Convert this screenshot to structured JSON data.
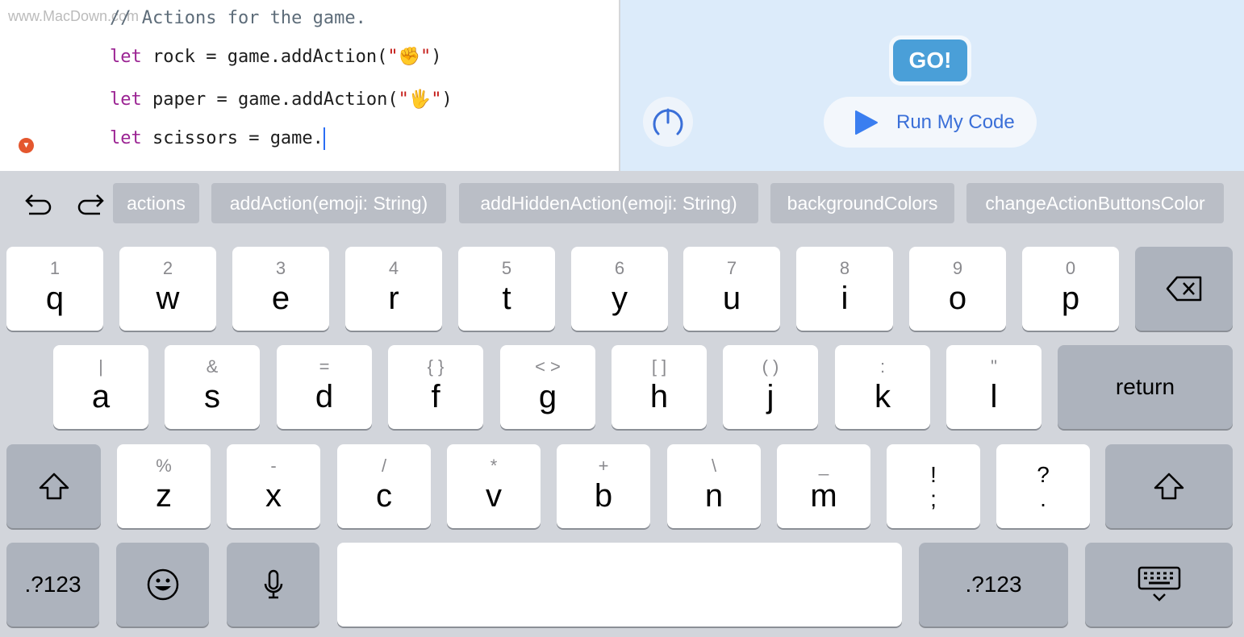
{
  "watermark": "www.MacDown.com",
  "code": {
    "comment": "// Actions for the game.",
    "lines": [
      {
        "kw": "let",
        "rest": " rock = game.addAction(",
        "q1": "\"",
        "emoji": "✊",
        "q2": "\"",
        "end": ")"
      },
      {
        "kw": "let",
        "rest": " paper = game.addAction(",
        "q1": "\"",
        "emoji": "🖐",
        "q2": "\"",
        "end": ")"
      },
      {
        "kw": "let",
        "rest": " scissors = game.",
        "q1": "",
        "emoji": "",
        "q2": "",
        "end": ""
      }
    ]
  },
  "live": {
    "go_label": "GO!",
    "run_label": "Run My Code",
    "accent": "#3a6fd8"
  },
  "suggestions": [
    "actions",
    "addAction(emoji: String)",
    "addHiddenAction(emoji: String)",
    "backgroundColors",
    "changeActionButtonsColor"
  ],
  "keyboard": {
    "row1": [
      [
        "1",
        "q"
      ],
      [
        "2",
        "w"
      ],
      [
        "3",
        "e"
      ],
      [
        "4",
        "r"
      ],
      [
        "5",
        "t"
      ],
      [
        "6",
        "y"
      ],
      [
        "7",
        "u"
      ],
      [
        "8",
        "i"
      ],
      [
        "9",
        "o"
      ],
      [
        "0",
        "p"
      ]
    ],
    "row2": [
      [
        "|",
        "a"
      ],
      [
        "&",
        "s"
      ],
      [
        "=",
        "d"
      ],
      [
        "{    }",
        "f"
      ],
      [
        "<    >",
        "g"
      ],
      [
        "[    ]",
        "h"
      ],
      [
        "(    )",
        "j"
      ],
      [
        ":",
        "k"
      ],
      [
        "\"",
        "l"
      ]
    ],
    "row3": [
      [
        "%",
        "z"
      ],
      [
        "-",
        "x"
      ],
      [
        "/",
        "c"
      ],
      [
        "*",
        "v"
      ],
      [
        "+",
        "b"
      ],
      [
        "\\",
        "n"
      ],
      [
        "_",
        "m"
      ],
      [
        "!",
        ";"
      ],
      [
        "?",
        "."
      ]
    ],
    "return_label": "return",
    "numbers_label": ".?123"
  }
}
